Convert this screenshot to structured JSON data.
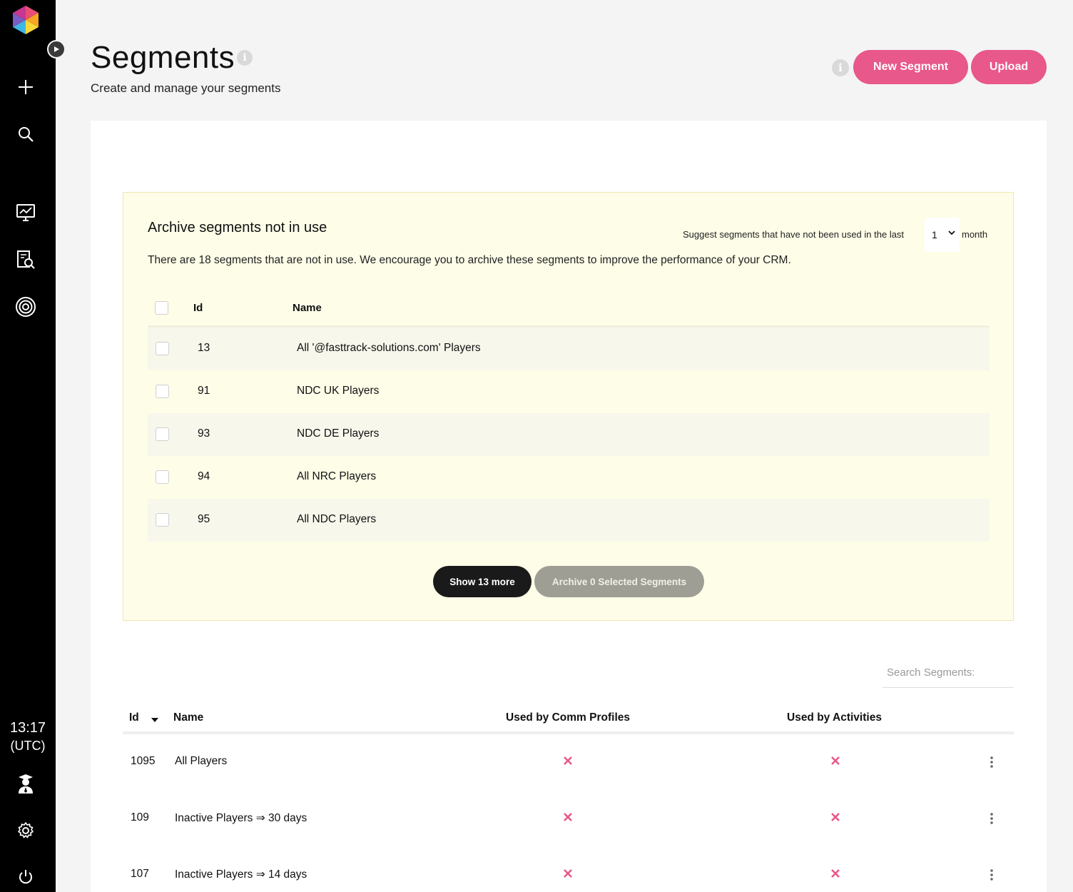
{
  "sidebar": {
    "time": "13:17",
    "timezone": "(UTC)"
  },
  "header": {
    "title": "Segments",
    "subtitle": "Create and manage your segments",
    "info_glyph": "i",
    "new_segment_label": "New Segment",
    "upload_label": "Upload"
  },
  "archive": {
    "title": "Archive segments not in use",
    "suggest_label": "Suggest segments that have not been used in the last",
    "months_value": "1",
    "month_label": "month",
    "description": "There are 18 segments that are not in use. We encourage you to archive these segments to improve the performance of your CRM.",
    "columns": {
      "id": "Id",
      "name": "Name"
    },
    "rows": [
      {
        "id": "13",
        "name": "All '@fasttrack-solutions.com' Players"
      },
      {
        "id": "91",
        "name": "NDC UK Players"
      },
      {
        "id": "93",
        "name": "NDC DE Players"
      },
      {
        "id": "94",
        "name": "All NRC Players"
      },
      {
        "id": "95",
        "name": "All NDC Players"
      }
    ],
    "show_more_label": "Show 13 more",
    "archive_button_label": "Archive 0 Selected Segments"
  },
  "segments_table": {
    "search_placeholder": "Search Segments:",
    "columns": {
      "id": "Id",
      "name": "Name",
      "comm_profiles": "Used by Comm Profiles",
      "activities": "Used by Activities"
    },
    "rows": [
      {
        "id": "1095",
        "name": "All Players"
      },
      {
        "id": "109",
        "name": "Inactive Players ⇒ 30 days"
      },
      {
        "id": "107",
        "name": "Inactive Players ⇒ 14 days"
      }
    ]
  },
  "colors": {
    "accent": "#e8588a",
    "sidebar_bg": "#000000",
    "archive_bg": "#fefde8",
    "dark_button": "#1a1a1a",
    "disabled_button": "#9e9e94",
    "cross": "#e8588a"
  }
}
